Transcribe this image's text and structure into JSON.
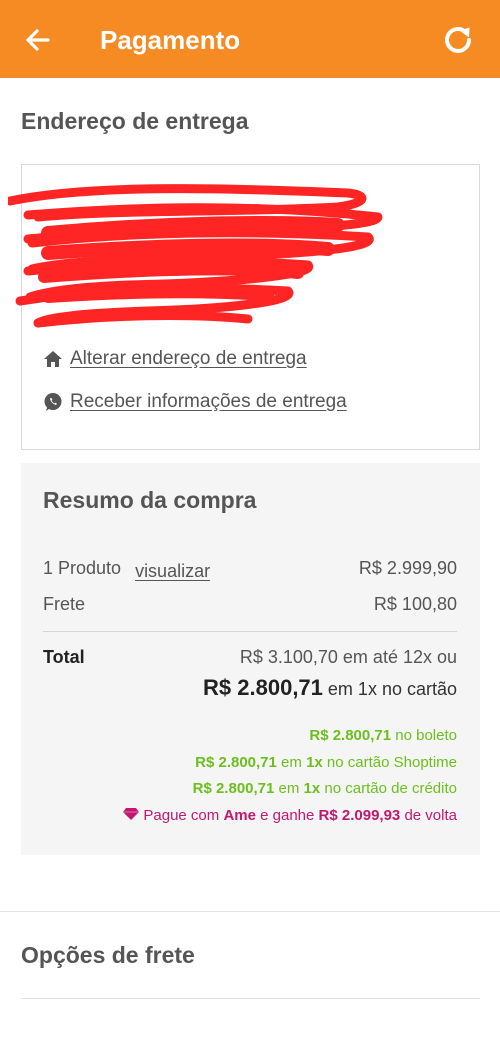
{
  "header": {
    "title": "Pagamento",
    "back_icon": "arrow-left-icon",
    "refresh_icon": "refresh-icon",
    "background": "#f68b24"
  },
  "address": {
    "section_title": "Endereço de entrega",
    "change_link": "Alterar endereço de entrega",
    "change_icon": "home-icon",
    "whatsapp_link": "Receber informações de entrega",
    "whatsapp_icon": "whatsapp-icon"
  },
  "summary": {
    "title": "Resumo da compra",
    "product_label": "1 Produto",
    "view_link": "visualizar",
    "product_price": "R$ 2.999,90",
    "shipping_label": "Frete",
    "shipping_price": "R$ 100,80",
    "total_label": "Total",
    "total_installments": "R$ 3.100,70 em até 12x ou",
    "total_cash_amount": "R$ 2.800,71",
    "total_cash_suffix": "em 1x no cartão",
    "offers": {
      "boleto_amount": "R$ 2.800,71",
      "boleto_text": "no boleto",
      "shoptime_amount": "R$ 2.800,71",
      "shoptime_mid": "em",
      "shoptime_times": "1x",
      "shoptime_text": "no cartão Shoptime",
      "credit_amount": "R$ 2.800,71",
      "credit_mid": "em",
      "credit_times": "1x",
      "credit_text": "no cartão de crédito",
      "ame_pre": "Pague com",
      "ame_brand": "Ame",
      "ame_mid": "e ganhe",
      "ame_amount": "R$ 2.099,93",
      "ame_post": "de volta",
      "ame_icon": "gem-icon"
    },
    "colors": {
      "green": "#6cbf1f",
      "pink": "#c2186f"
    }
  },
  "shipping_options": {
    "title": "Opções de frete"
  }
}
